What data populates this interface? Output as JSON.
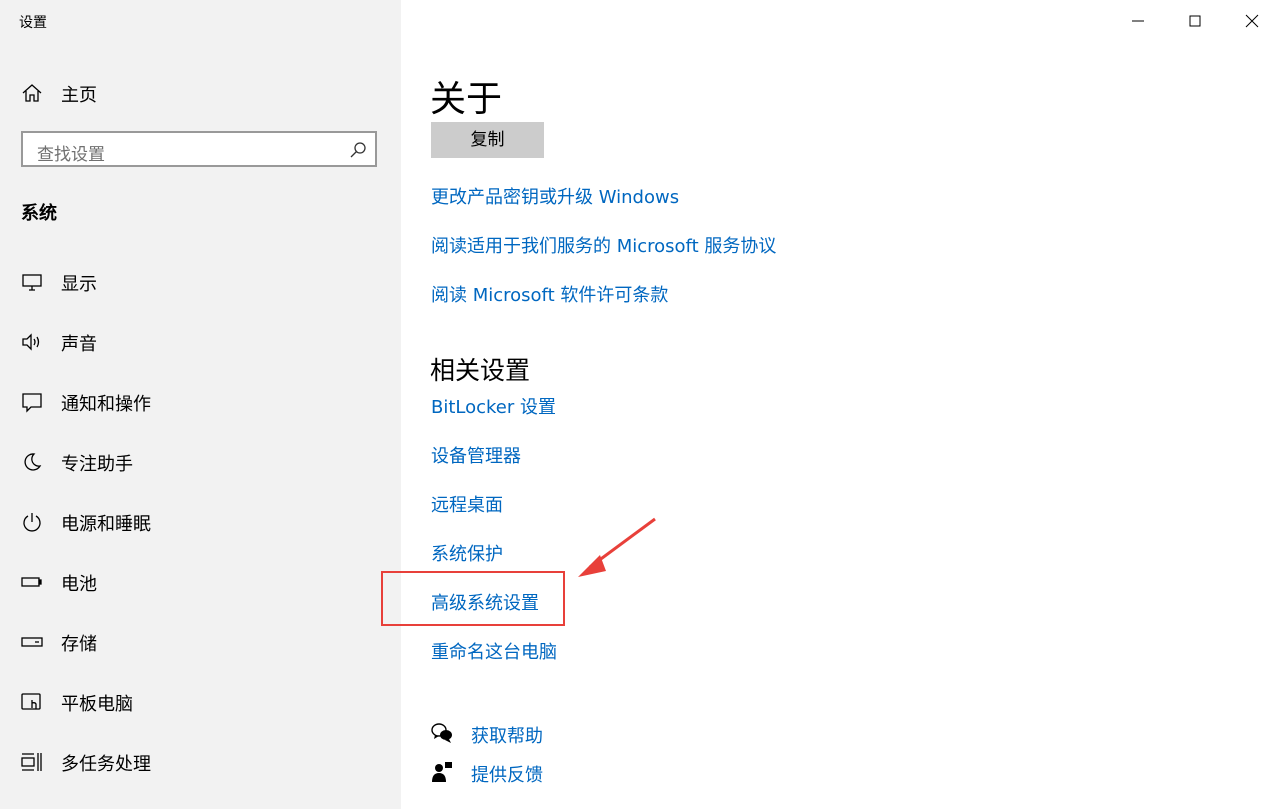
{
  "window": {
    "title": "设置",
    "controls": [
      "minimize",
      "maximize",
      "close"
    ]
  },
  "sidebar": {
    "home_label": "主页",
    "search_placeholder": "查找设置",
    "section_title": "系统",
    "items": [
      {
        "label": "显示",
        "icon": "display-icon"
      },
      {
        "label": "声音",
        "icon": "speaker-icon"
      },
      {
        "label": "通知和操作",
        "icon": "notification-icon"
      },
      {
        "label": "专注助手",
        "icon": "moon-icon"
      },
      {
        "label": "电源和睡眠",
        "icon": "power-icon"
      },
      {
        "label": "电池",
        "icon": "battery-icon"
      },
      {
        "label": "存储",
        "icon": "storage-icon"
      },
      {
        "label": "平板电脑",
        "icon": "tablet-icon"
      },
      {
        "label": "多任务处理",
        "icon": "multitask-icon"
      }
    ]
  },
  "main": {
    "title": "关于",
    "copy_button": "复制",
    "links": [
      "更改产品密钥或升级 Windows",
      "阅读适用于我们服务的 Microsoft 服务协议",
      "阅读 Microsoft 软件许可条款"
    ],
    "related_title": "相关设置",
    "related_links": [
      "BitLocker 设置",
      "设备管理器",
      "远程桌面",
      "系统保护",
      "高级系统设置",
      "重命名这台电脑"
    ],
    "help": {
      "get_help": "获取帮助",
      "feedback": "提供反馈"
    }
  },
  "annotation": {
    "highlight_color": "#e8403a",
    "highlighted_item": "高级系统设置"
  },
  "colors": {
    "link": "#0067c0",
    "sidebar_bg": "#f2f2f2",
    "button_bg": "#cccccc"
  }
}
